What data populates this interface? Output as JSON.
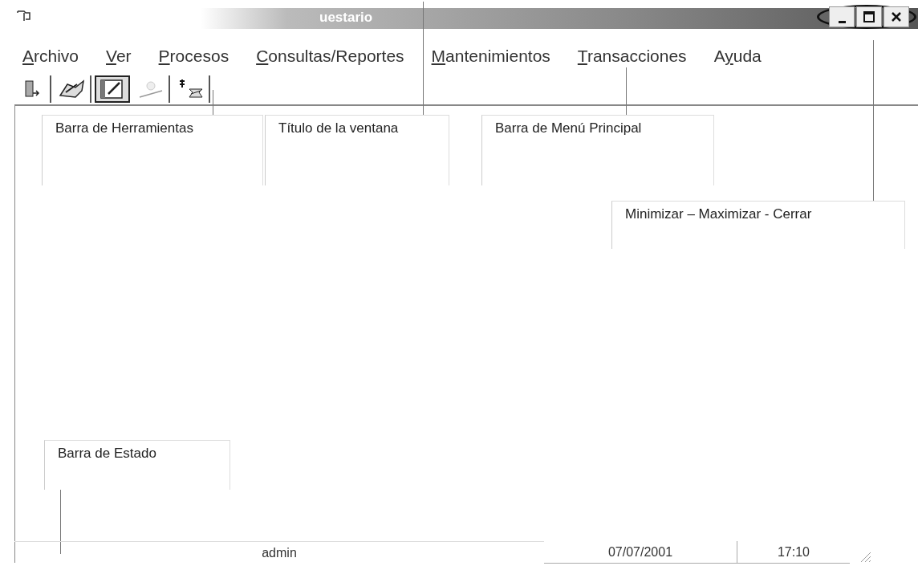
{
  "window": {
    "title": "uestario",
    "controls": [
      {
        "kind": "minimize"
      },
      {
        "kind": "maximize"
      },
      {
        "kind": "close"
      }
    ]
  },
  "menu": [
    {
      "access_key": "A",
      "label_rest": "rchivo"
    },
    {
      "access_key": "V",
      "label_rest": "er"
    },
    {
      "access_key": "P",
      "label_rest": "rocesos"
    },
    {
      "access_key": "C",
      "label_rest": "onsultas/Reportes"
    },
    {
      "access_key": "M",
      "label_rest": "antenimientos"
    },
    {
      "access_key": "T",
      "label_rest": "ransacciones"
    },
    {
      "label_start": "A",
      "access_key": "y",
      "label_rest": "uda"
    }
  ],
  "toolbar": [
    {
      "kind": "exit",
      "pressed": false
    },
    {
      "kind": "hand",
      "pressed": false
    },
    {
      "kind": "pen",
      "pressed": true
    },
    {
      "kind": "chart",
      "pressed": false
    },
    {
      "kind": "money",
      "pressed": false
    }
  ],
  "callouts": [
    {
      "text": "Barra de Herramientas"
    },
    {
      "text": "Título de la ventana"
    },
    {
      "text": "Barra de Menú Principal"
    },
    {
      "text": "Minimizar – Maximizar - Cerrar"
    },
    {
      "text": "Barra de Estado"
    }
  ],
  "status_bar": {
    "user": "admin",
    "date": "07/07/2001",
    "time": "17:10"
  }
}
